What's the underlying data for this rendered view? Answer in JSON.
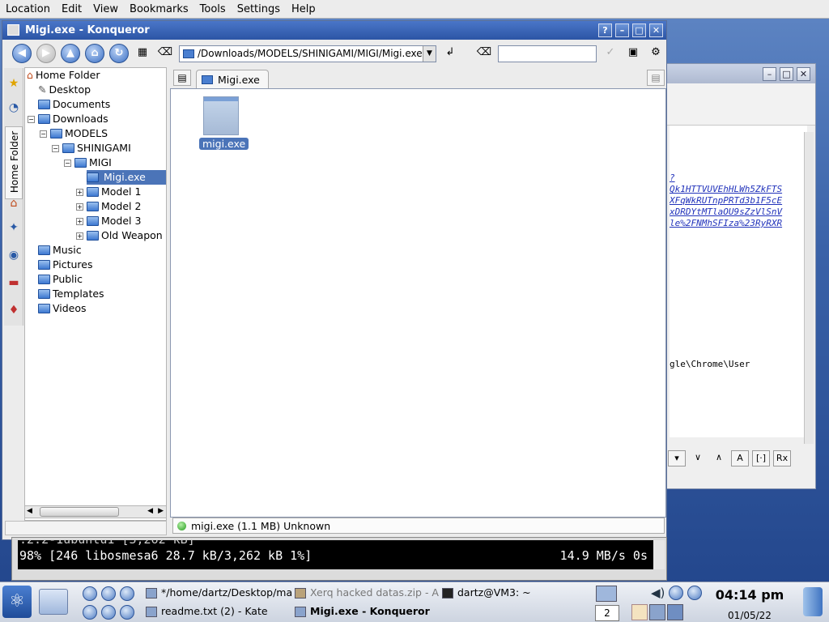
{
  "menubar": {
    "items": [
      "Location",
      "Edit",
      "View",
      "Bookmarks",
      "Tools",
      "Settings",
      "Help"
    ]
  },
  "window": {
    "title": "Migi.exe - Konqueror",
    "buttons": [
      "?",
      "–",
      "□",
      "✕"
    ]
  },
  "toolbar": {
    "url": "/Downloads/MODELS/SHINIGAMI/MIGI/Migi.exe",
    "search_value": ""
  },
  "sidebar": {
    "tab_label": "Home Folder"
  },
  "tree": {
    "items": [
      {
        "label": "Home Folder",
        "depth": 0
      },
      {
        "label": "Desktop",
        "depth": 1
      },
      {
        "label": "Documents",
        "depth": 1
      },
      {
        "label": "Downloads",
        "depth": 1
      },
      {
        "label": "MODELS",
        "depth": 2
      },
      {
        "label": "SHINIGAMI",
        "depth": 3
      },
      {
        "label": "MIGI",
        "depth": 4
      },
      {
        "label": "Migi.exe",
        "depth": 5
      },
      {
        "label": "Model 1",
        "depth": 5
      },
      {
        "label": "Model 2",
        "depth": 5
      },
      {
        "label": "Model 3",
        "depth": 5
      },
      {
        "label": "Old Weapon S",
        "depth": 5
      },
      {
        "label": "Music",
        "depth": 1
      },
      {
        "label": "Pictures",
        "depth": 1
      },
      {
        "label": "Public",
        "depth": 1
      },
      {
        "label": "Templates",
        "depth": 1
      },
      {
        "label": "Videos",
        "depth": 1
      }
    ]
  },
  "view": {
    "tab_label": "Migi.exe",
    "file_label": "migi.exe"
  },
  "statusbar": {
    "text": "migi.exe (1.1 MB)  Unknown"
  },
  "bg_window": {
    "links": [
      "?",
      "Qk1HTTVUVEhHLWh5ZkFTS",
      "XFqWkRUTnpPRTd3b1F5cE",
      "xDRDYtMTlaOU9sZzVlSnV",
      "le%2FNMhSFIza%23RyRXR"
    ],
    "path_text": "gle\\Chrome\\User"
  },
  "terminal": {
    "line1": ".2.2-1ubuntu1 [3,262 kB]",
    "line2": "98% [246 libosmesa6 28.7 kB/3,262 kB 1%]",
    "line3": "14.9 MB/s 0s"
  },
  "taskbar": {
    "tasks": [
      {
        "label": "*/home/dartz/Desktop/ma",
        "state": "normal"
      },
      {
        "label": "Xerq hacked datas.zip - A",
        "state": "dim"
      },
      {
        "label": "dartz@VM3: ~",
        "state": "normal"
      },
      {
        "label": "readme.txt (2) - Kate",
        "state": "normal"
      },
      {
        "label": "Migi.exe - Konqueror",
        "state": "active"
      }
    ],
    "pager": "2",
    "clock": "04:14 pm",
    "date": "01/05/22"
  }
}
